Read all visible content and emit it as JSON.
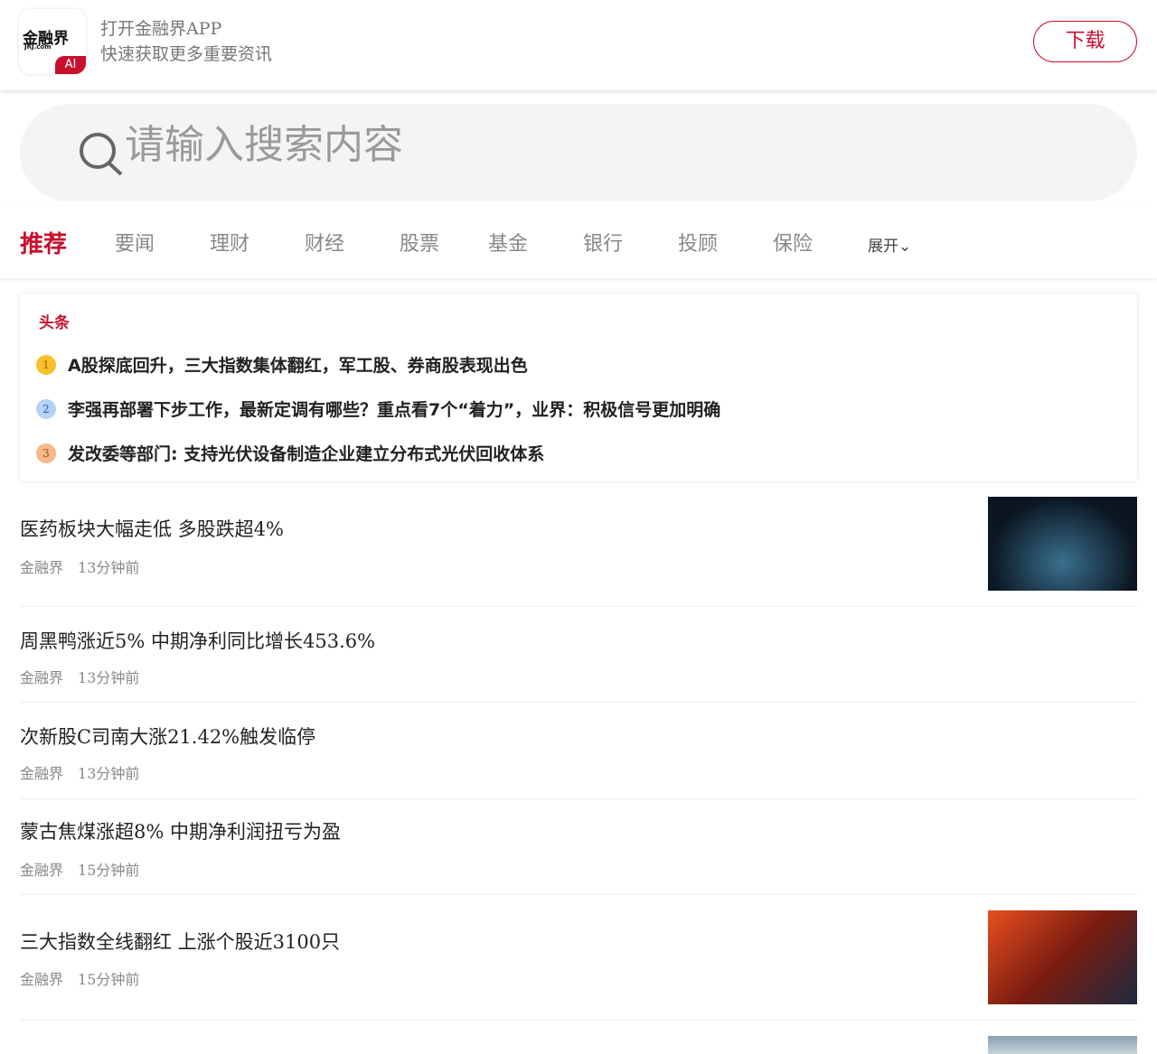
{
  "banner": {
    "logo_text": "金融界",
    "logo_sub": "JRJ.com",
    "logo_badge": "AI",
    "line1": "打开金融界APP",
    "line2": "快速获取更多重要资讯",
    "download": "下载"
  },
  "search": {
    "placeholder": "请输入搜索内容"
  },
  "tabs": [
    "推荐",
    "要闻",
    "理财",
    "财经",
    "股票",
    "基金",
    "银行",
    "投顾",
    "保险",
    "展开"
  ],
  "headlines": {
    "label": "头条",
    "items": [
      {
        "rank": "1",
        "title": "A股探底回升，三大指数集体翻红，军工股、券商股表现出色"
      },
      {
        "rank": "2",
        "title": "李强再部署下步工作，最新定调有哪些？重点看7个“着力”，业界：积极信号更加明确"
      },
      {
        "rank": "3",
        "title": "发改委等部门: 支持光伏设备制造企业建立分布式光伏回收体系"
      }
    ]
  },
  "news": [
    {
      "title": "医药板块大幅走低 多股跌超4%",
      "source": "金融界",
      "time": "13分钟前"
    },
    {
      "title": "周黑鸭涨近5% 中期净利同比增长453.6%",
      "source": "金融界",
      "time": "13分钟前"
    },
    {
      "title": "次新股C司南大涨21.42%触发临停",
      "source": "金融界",
      "time": "13分钟前"
    },
    {
      "title": "蒙古焦煤涨超8% 中期净利润扭亏为盈",
      "source": "金融界",
      "time": "15分钟前"
    },
    {
      "title": "三大指数全线翻红 上涨个股近3100只",
      "source": "金融界",
      "time": "15分钟前"
    }
  ]
}
